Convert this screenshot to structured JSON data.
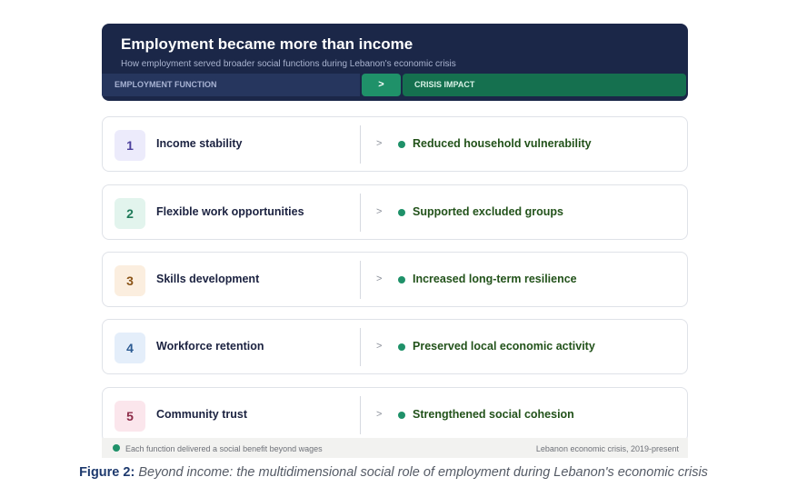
{
  "header": {
    "title": "Employment became more than income",
    "subtitle": "How employment served broader social functions during Lebanon's economic crisis",
    "left_column_label": "EMPLOYMENT FUNCTION",
    "arrow_label": ">",
    "right_column_label": "CRISIS IMPACT"
  },
  "rows": [
    {
      "number": "1",
      "function": "Income stability",
      "arrow": ">",
      "impact": "Reduced household vulnerability",
      "badge_bg": "#ecebfb",
      "badge_color": "#4b3f9c"
    },
    {
      "number": "2",
      "function": "Flexible work opportunities",
      "arrow": ">",
      "impact": "Supported excluded groups",
      "badge_bg": "#e2f4ed",
      "badge_color": "#1f7a59"
    },
    {
      "number": "3",
      "function": "Skills development",
      "arrow": ">",
      "impact": "Increased long-term resilience",
      "badge_bg": "#fbeedf",
      "badge_color": "#8a5316"
    },
    {
      "number": "4",
      "function": "Workforce retention",
      "arrow": ">",
      "impact": "Preserved local economic activity",
      "badge_bg": "#e4eefa",
      "badge_color": "#2b5a92"
    },
    {
      "number": "5",
      "function": "Community trust",
      "arrow": ">",
      "impact": "Strengthened social cohesion",
      "badge_bg": "#fbe6ec",
      "badge_color": "#8c2a47"
    }
  ],
  "footer": {
    "note": "Each function delivered a social benefit beyond wages",
    "source": "Lebanon economic crisis, 2019-present"
  },
  "caption": {
    "label": "Figure 2:",
    "text": "Beyond income: the multidimensional social role of employment during Lebanon's economic crisis"
  },
  "colors": {
    "header_bg": "#1b2748",
    "accent_green": "#1f9169",
    "impact_text": "#22521a"
  }
}
